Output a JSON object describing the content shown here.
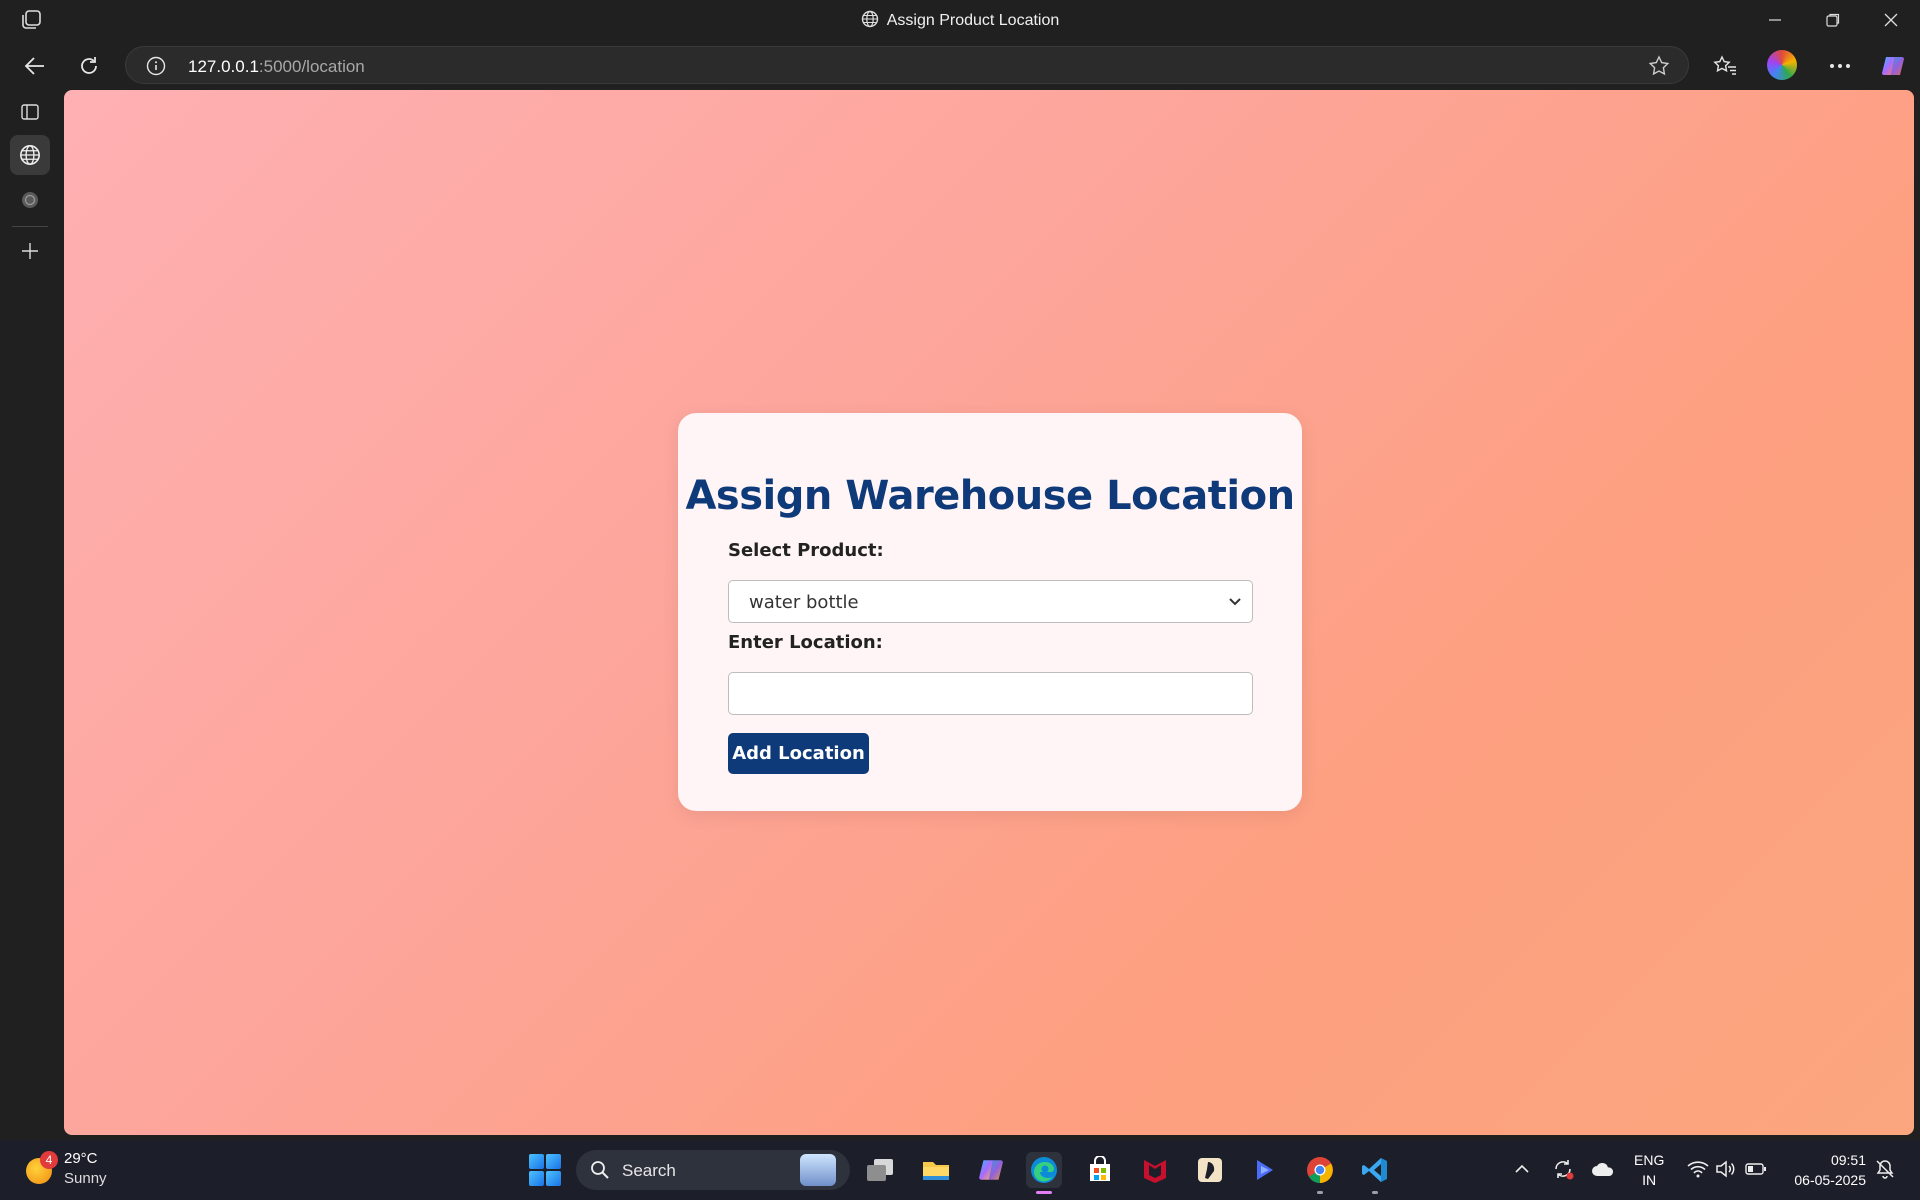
{
  "window": {
    "title": "Assign Product Location"
  },
  "toolbar": {
    "url_host": "127.0.0.1",
    "url_path": ":5000/location"
  },
  "page": {
    "heading": "Assign Warehouse Location",
    "product_label": "Select Product:",
    "product_selected": "water bottle",
    "location_label": "Enter Location:",
    "location_value": "",
    "submit_label": "Add Location",
    "colors": {
      "heading": "#0e3a7a",
      "button": "#0e3a7a",
      "card": "#fff5f6"
    }
  },
  "taskbar": {
    "weather_temp": "29°C",
    "weather_condition": "Sunny",
    "weather_badge": "4",
    "search_placeholder": "Search",
    "language": "ENG",
    "region": "IN",
    "time": "09:51",
    "date": "06-05-2025"
  }
}
